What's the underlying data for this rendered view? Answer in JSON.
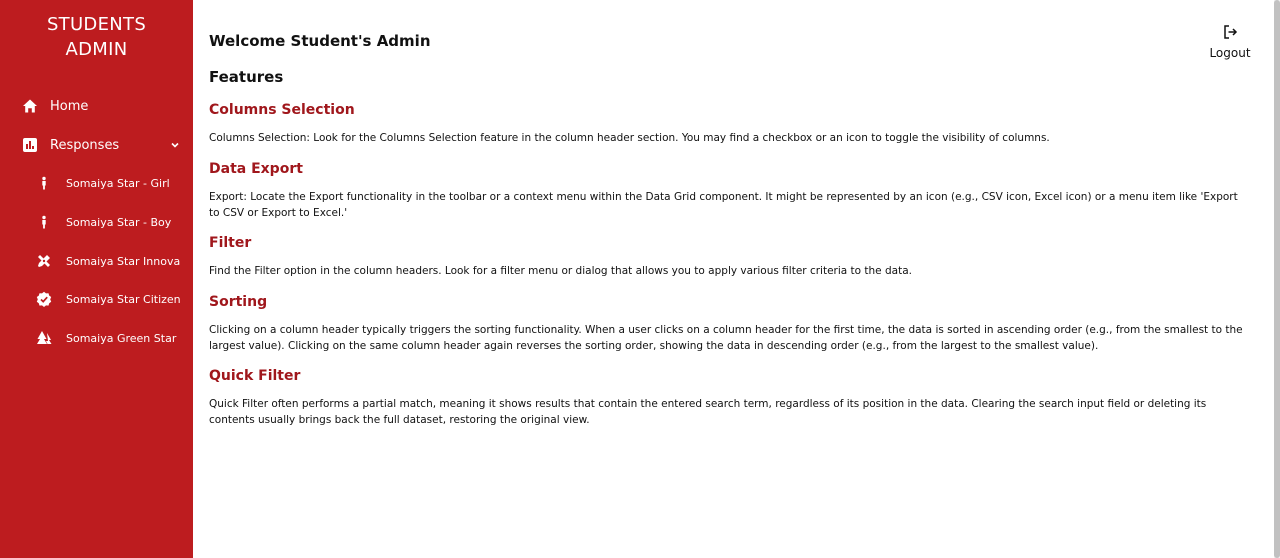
{
  "sidebar": {
    "brand_line1": "STUDENTS",
    "brand_line2": "ADMIN",
    "items": [
      {
        "label": "Home",
        "icon": "home-icon"
      },
      {
        "label": "Responses",
        "icon": "bar-chart-icon"
      }
    ],
    "sub_items": [
      {
        "label": "Somaiya Star - Girl",
        "icon": "person-icon"
      },
      {
        "label": "Somaiya Star - Boy",
        "icon": "person-icon"
      },
      {
        "label": "Somaiya Star Innova",
        "icon": "tools-icon"
      },
      {
        "label": "Somaiya Star Citizen",
        "icon": "verified-badge-icon"
      },
      {
        "label": "Somaiya Green Star",
        "icon": "forest-icon"
      }
    ]
  },
  "header": {
    "welcome": "Welcome Student's Admin",
    "features": "Features",
    "logout_label": "Logout"
  },
  "sections": [
    {
      "title": "Columns Selection",
      "text": "Columns Selection: Look for the Columns Selection feature in the column header section. You may find a checkbox or an icon to toggle the visibility of columns."
    },
    {
      "title": "Data Export",
      "text": "Export: Locate the Export functionality in the toolbar or a context menu within the Data Grid component. It might be represented by an icon (e.g., CSV icon, Excel icon) or a menu item like 'Export to CSV or Export to Excel.'"
    },
    {
      "title": "Filter",
      "text": "Find the Filter option in the column headers. Look for a filter menu or dialog that allows you to apply various filter criteria to the data."
    },
    {
      "title": "Sorting",
      "text": "Clicking on a column header typically triggers the sorting functionality. When a user clicks on a column header for the first time, the data is sorted in ascending order (e.g., from the smallest to the largest value). Clicking on the same column header again reverses the sorting order, showing the data in descending order (e.g., from the largest to the smallest value)."
    },
    {
      "title": "Quick Filter",
      "text": "Quick Filter often performs a partial match, meaning it shows results that contain the entered search term, regardless of its position in the data. Clearing the search input field or deleting its contents usually brings back the full dataset, restoring the original view."
    }
  ],
  "colors": {
    "sidebar_bg": "#bd1c1f",
    "section_title": "#a0171c"
  }
}
